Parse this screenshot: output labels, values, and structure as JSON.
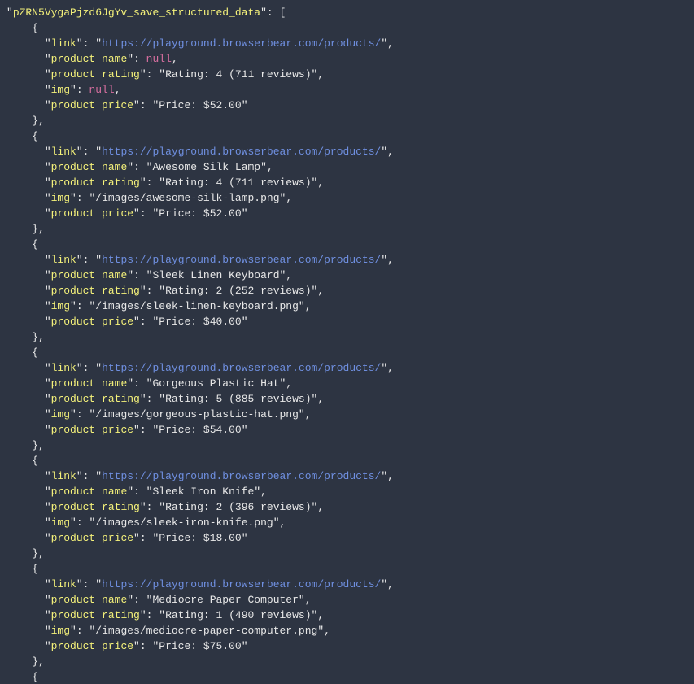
{
  "json": {
    "root_key": "pZRN5VygaPjzd6JgYv_save_structured_data",
    "items": [
      {
        "link": "https://playground.browserbear.com/products/",
        "product_name": null,
        "product_rating": "Rating: 4 (711 reviews)",
        "img": null,
        "product_price": "Price: $52.00"
      },
      {
        "link": "https://playground.browserbear.com/products/",
        "product_name": "Awesome Silk Lamp",
        "product_rating": "Rating: 4 (711 reviews)",
        "img": "/images/awesome-silk-lamp.png",
        "product_price": "Price: $52.00"
      },
      {
        "link": "https://playground.browserbear.com/products/",
        "product_name": "Sleek Linen Keyboard",
        "product_rating": "Rating: 2 (252 reviews)",
        "img": "/images/sleek-linen-keyboard.png",
        "product_price": "Price: $40.00"
      },
      {
        "link": "https://playground.browserbear.com/products/",
        "product_name": "Gorgeous Plastic Hat",
        "product_rating": "Rating: 5 (885 reviews)",
        "img": "/images/gorgeous-plastic-hat.png",
        "product_price": "Price: $54.00"
      },
      {
        "link": "https://playground.browserbear.com/products/",
        "product_name": "Sleek Iron Knife",
        "product_rating": "Rating: 2 (396 reviews)",
        "img": "/images/sleek-iron-knife.png",
        "product_price": "Price: $18.00"
      },
      {
        "link": "https://playground.browserbear.com/products/",
        "product_name": "Mediocre Paper Computer",
        "product_rating": "Rating: 1 (490 reviews)",
        "img": "/images/mediocre-paper-computer.png",
        "product_price": "Price: $75.00"
      }
    ]
  },
  "labels": {
    "link": "link",
    "product_name": "product name",
    "product_rating": "product rating",
    "img": "img",
    "product_price": "product price",
    "null": "null"
  }
}
